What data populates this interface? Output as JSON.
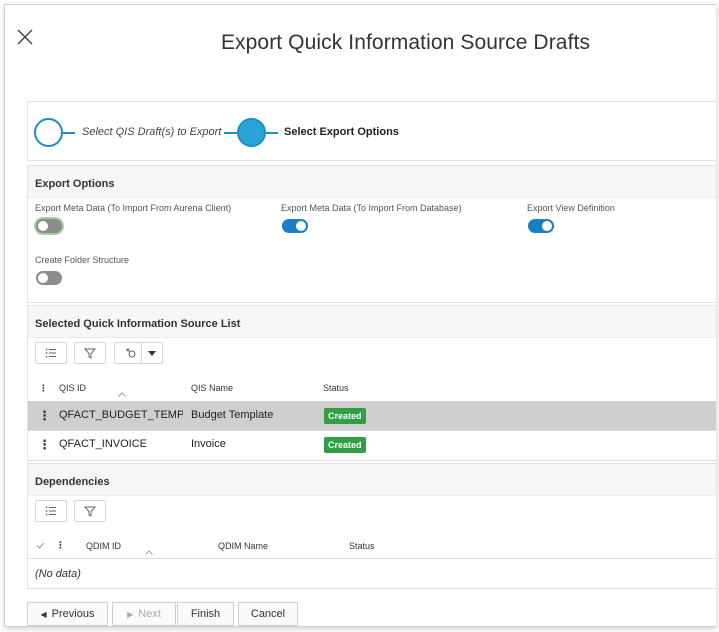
{
  "dialog": {
    "title": "Export Quick Information Source Drafts"
  },
  "stepper": {
    "step1_label": "Select QIS Draft(s) to Export",
    "step2_label": "Select Export Options"
  },
  "options": {
    "title": "Export Options",
    "items": [
      {
        "label": "Export Meta Data (To Import From Aurena Client)",
        "state": "off"
      },
      {
        "label": "Export Meta Data (To Import From Database)",
        "state": "on"
      },
      {
        "label": "Export View Definition",
        "state": "on"
      },
      {
        "label": "Create Folder Structure",
        "state": "off"
      }
    ]
  },
  "qis_list": {
    "title": "Selected Quick Information Source List",
    "columns": [
      "QIS ID",
      "QIS Name",
      "Status"
    ],
    "rows": [
      {
        "id": "QFACT_BUDGET_TEMP...",
        "name": "Budget Template",
        "status": "Created",
        "selected": true
      },
      {
        "id": "QFACT_INVOICE",
        "name": "Invoice",
        "status": "Created",
        "selected": false
      }
    ]
  },
  "dependencies": {
    "title": "Dependencies",
    "columns": [
      "QDIM ID",
      "QDIM Name",
      "Status"
    ],
    "empty_text": "(No data)"
  },
  "footer": {
    "previous": "Previous",
    "next": "Next",
    "finish": "Finish",
    "cancel": "Cancel"
  },
  "colors": {
    "accent": "#1b8fbf",
    "toggle_on": "#1b7fc4",
    "badge_created": "#2f9e44"
  },
  "icons": {
    "close": "close-icon",
    "list": "list-icon",
    "filter": "filter-icon",
    "export_settings": "settings-icon",
    "dropdown": "caret-down-icon"
  }
}
